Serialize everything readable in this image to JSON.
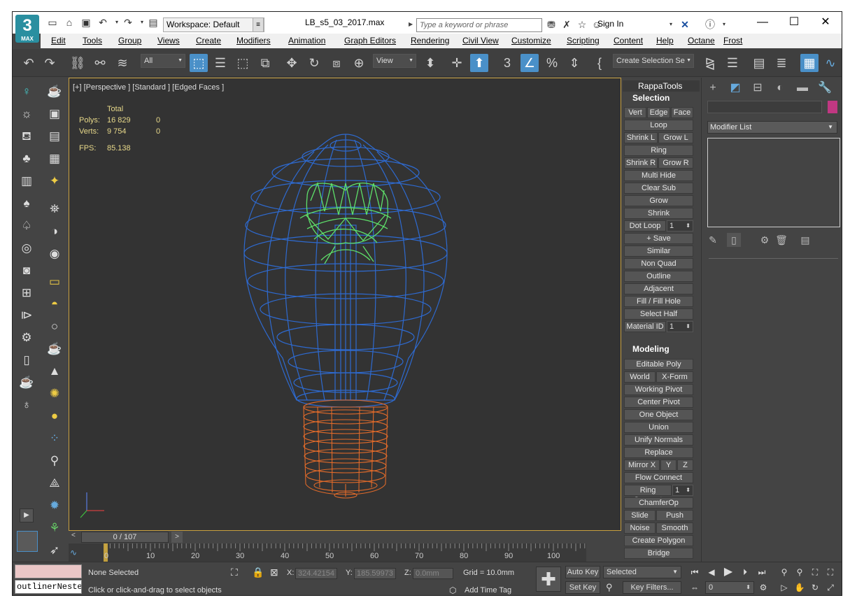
{
  "app": {
    "logo": "3",
    "logo_sub": "MAX",
    "file_title": "LB_s5_03_2017.max"
  },
  "workspace": {
    "label": "Workspace: Default"
  },
  "search": {
    "placeholder": "Type a keyword or phrase"
  },
  "signin": {
    "label": "Sign In"
  },
  "menu": [
    "Edit",
    "Tools",
    "Group",
    "Views",
    "Create",
    "Modifiers",
    "Animation",
    "Graph Editors",
    "Rendering",
    "Civil View",
    "Customize",
    "Scripting",
    "Content",
    "Help",
    "Octane",
    "Frost"
  ],
  "toolbar": {
    "filter": "All",
    "refcoord": "View",
    "selection_set": "Create Selection Se"
  },
  "viewport": {
    "label": "[+] [Perspective ] [Standard ] [Edged Faces ]",
    "stats_header": "Total",
    "polys_label": "Polys:",
    "polys_value": "16 829",
    "polys_sel": "0",
    "verts_label": "Verts:",
    "verts_value": "9 754",
    "verts_sel": "0",
    "fps_label": "FPS:",
    "fps_value": "85.138"
  },
  "rappa": {
    "title": "RappaTools",
    "selection_header": "Selection",
    "modeling_header": "Modeling",
    "sel": {
      "vert": "Vert",
      "edge": "Edge",
      "face": "Face",
      "loop": "Loop",
      "shrink_l": "Shrink L",
      "grow_l": "Grow L",
      "ring": "Ring",
      "shrink_r": "Shrink R",
      "grow_r": "Grow R",
      "multi_hide": "Multi Hide",
      "clear_sub": "Clear Sub",
      "grow": "Grow",
      "shrink": "Shrink",
      "dot_loop": "Dot Loop",
      "dot_loop_val": "1",
      "save": "+ Save",
      "similar": "Similar",
      "non_quad": "Non Quad",
      "outline": "Outline",
      "adjacent": "Adjacent",
      "fill": "Fill / Fill Hole",
      "select_half": "Select Half",
      "material_id": "Material ID",
      "material_id_val": "1"
    },
    "mod": {
      "editable_poly": "Editable Poly",
      "world": "World",
      "xform": "X-Form",
      "working_pivot": "Working Pivot",
      "center_pivot": "Center Pivot",
      "one_object": "One Object",
      "union": "Union",
      "unify_normals": "Unify Normals",
      "replace": "Replace",
      "mirror_x": "Mirror X",
      "y": "Y",
      "z": "Z",
      "flow_connect": "Flow Connect",
      "ring_connect": "Ring Connect",
      "ring_connect_val": "1",
      "chamferop": "ChamferOp",
      "slide": "Slide",
      "push": "Push",
      "noise": "Noise",
      "smooth": "Smooth",
      "create_polygon": "Create Polygon",
      "bridge": "Bridge"
    }
  },
  "cmdpanel": {
    "modifier_list": "Modifier List",
    "accent_color": "#c03882"
  },
  "timeslider": {
    "value": "0 / 107"
  },
  "trackbar": {
    "ticks": [
      "0",
      "10",
      "20",
      "30",
      "40",
      "50",
      "60",
      "70",
      "80",
      "90",
      "100"
    ]
  },
  "status": {
    "outliner_field": "outlinerNeste",
    "none_selected": "None Selected",
    "prompt": "Click or click-and-drag to select objects",
    "x_label": "X:",
    "x_value": "324.42154",
    "y_label": "Y:",
    "y_value": "185.59973",
    "z_label": "Z:",
    "z_value": "0.0mm",
    "grid": "Grid = 10.0mm",
    "add_time_tag": "Add Time Tag",
    "auto_key": "Auto Key",
    "set_key": "Set Key",
    "key_mode": "Selected",
    "key_filters": "Key Filters...",
    "frame": "0"
  }
}
